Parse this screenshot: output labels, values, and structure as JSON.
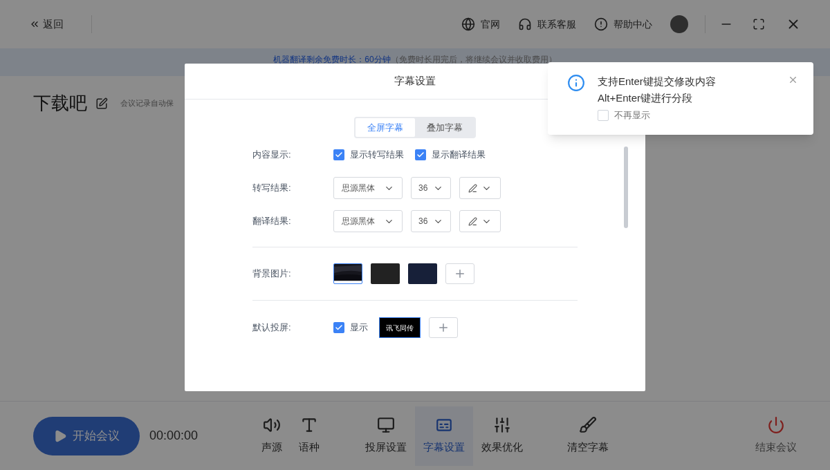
{
  "header": {
    "back": "返回",
    "links": [
      {
        "label": "官网",
        "kind": "globe"
      },
      {
        "label": "联系客服",
        "kind": "headset"
      },
      {
        "label": "帮助中心",
        "kind": "alert"
      }
    ]
  },
  "banner": {
    "main": "机器翻译剩余免费时长：60分钟",
    "note": "（免费时长用完后，将继续会议并收取费用）"
  },
  "meeting": {
    "title": "下载吧",
    "note": "会议记录自动保"
  },
  "modal": {
    "title": "字幕设置",
    "tabs": [
      {
        "label": "全屏字幕",
        "selected": true
      },
      {
        "label": "叠加字幕",
        "selected": false
      }
    ],
    "content": {
      "label": "内容显示:",
      "options": [
        {
          "label": "显示转写结果",
          "checked": true
        },
        {
          "label": "显示翻译结果",
          "checked": true
        }
      ]
    },
    "fonts": [
      {
        "label": "转写结果:",
        "font": "思源黑体",
        "size": "36"
      },
      {
        "label": "翻译结果:",
        "font": "思源黑体",
        "size": "36"
      }
    ],
    "background": {
      "label": "背景图片:",
      "items": [
        {
          "kind": "picture",
          "selected": true
        },
        {
          "kind": "swatch",
          "color": "#222222",
          "selected": false
        },
        {
          "kind": "swatch",
          "color": "#172039",
          "selected": false
        }
      ]
    },
    "projection": {
      "label": "默认投屏:",
      "show": {
        "label": "显示",
        "checked": true
      },
      "logos": [
        {
          "text": "讯飞同传",
          "selected": true
        }
      ]
    }
  },
  "toast": {
    "lines": [
      "支持Enter键提交修改内容",
      "Alt+Enter键进行分段"
    ],
    "checkbox": {
      "label": "不再显示",
      "checked": false
    }
  },
  "toolbar": {
    "start": "开始会议",
    "timer": "00:00:00",
    "tools": [
      {
        "label": "声源",
        "kind": "volume",
        "selected": false
      },
      {
        "label": "语种",
        "kind": "language",
        "selected": false
      },
      {
        "label": "投屏设置",
        "kind": "screen",
        "selected": false
      },
      {
        "label": "字幕设置",
        "kind": "caption",
        "selected": true
      },
      {
        "label": "效果优化",
        "kind": "sliders",
        "selected": false
      },
      {
        "label": "清空字幕",
        "kind": "brush",
        "selected": false
      }
    ],
    "end": "结束会议"
  }
}
